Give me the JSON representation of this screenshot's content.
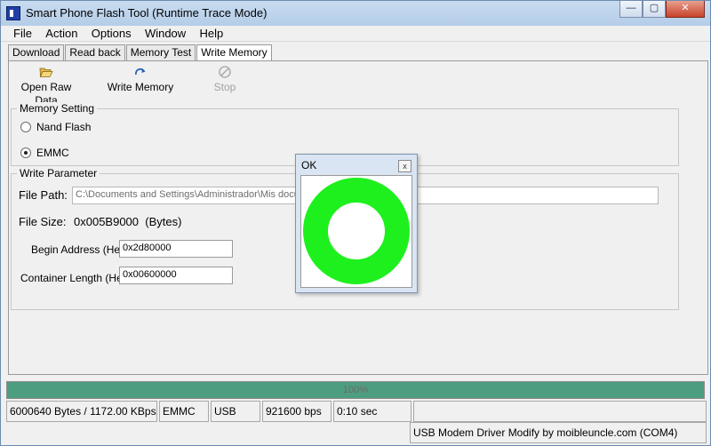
{
  "window": {
    "title": "Smart Phone Flash Tool (Runtime Trace Mode)",
    "controls": {
      "minimize": "—",
      "maximize": "▢",
      "close": "✕"
    }
  },
  "menu": [
    "File",
    "Action",
    "Options",
    "Window",
    "Help"
  ],
  "tabs": [
    {
      "label": "Download",
      "active": false
    },
    {
      "label": "Read back",
      "active": false
    },
    {
      "label": "Memory Test",
      "active": false
    },
    {
      "label": "Write Memory",
      "active": true
    }
  ],
  "toolbar": {
    "open_raw_data": {
      "label": "Open Raw Data",
      "icon": "folder-open-icon"
    },
    "write_memory": {
      "label": "Write Memory",
      "icon": "arrow-redo-icon"
    },
    "stop": {
      "label": "Stop",
      "icon": "stop-icon",
      "enabled": false
    }
  },
  "memory_setting": {
    "legend": "Memory Setting",
    "options": [
      {
        "label": "Nand Flash",
        "selected": false
      },
      {
        "label": "EMMC",
        "selected": true
      }
    ]
  },
  "write_parameter": {
    "legend": "Write Parameter",
    "file_path_label": "File Path:",
    "file_path_value": "C:\\Documents and Settings\\Administrador\\Mis documen",
    "file_size_label": "File Size:",
    "file_size_value": "0x005B9000  (Bytes)",
    "begin_address_label": "Begin Address (Hex) :",
    "begin_address_value": "0x2d80000",
    "container_length_label": "Container Length (Hex) :",
    "container_length_value": "0x00600000"
  },
  "progress": {
    "text": "100%",
    "value": 1.0,
    "color": "#4d9e80"
  },
  "status": {
    "transfer": "6000640 Bytes / 1172.00 KBps",
    "storage": "EMMC",
    "interface": "USB",
    "baud": "921600 bps",
    "time": "0:10 sec",
    "driver": "USB Modem Driver Modify by moibleuncle.com (COM4)"
  },
  "ok_dialog": {
    "title": "OK",
    "close": "x",
    "ring_color": "#1ef01e"
  }
}
